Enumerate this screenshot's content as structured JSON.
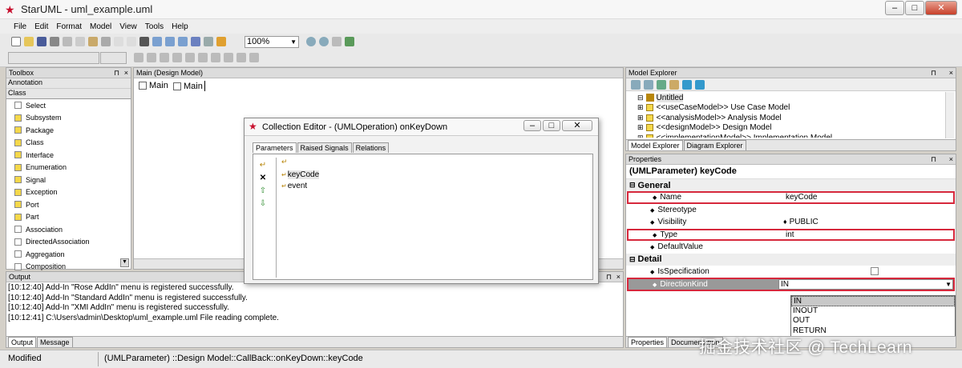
{
  "window": {
    "title": "StarUML - uml_example.uml"
  },
  "menu": [
    "File",
    "Edit",
    "Format",
    "Model",
    "View",
    "Tools",
    "Help"
  ],
  "toolbar": {
    "zoom": "100%"
  },
  "toolbox": {
    "header": "Toolbox",
    "groups": [
      "Annotation",
      "Class"
    ],
    "items": [
      "Select",
      "Subsystem",
      "Package",
      "Class",
      "Interface",
      "Enumeration",
      "Signal",
      "Exception",
      "Port",
      "Part",
      "Association",
      "DirectedAssociation",
      "Aggregation",
      "Composition"
    ]
  },
  "diagram": {
    "header": "Main (Design Model)",
    "tabs": [
      "Main",
      "Main"
    ]
  },
  "dialog": {
    "title": "Collection Editor - (UMLOperation) onKeyDown",
    "tabs": [
      "Parameters",
      "Raised Signals",
      "Relations"
    ],
    "params": [
      "keyCode",
      "event"
    ]
  },
  "model_explorer": {
    "header": "Model Explorer",
    "root": "Untitled",
    "items": [
      "<<useCaseModel>> Use Case Model",
      "<<analysisModel>> Analysis Model",
      "<<designModel>> Design Model",
      "<<implementationModel>> Implementation Model"
    ],
    "tabs": [
      "Model Explorer",
      "Diagram Explorer"
    ]
  },
  "properties": {
    "header": "Properties",
    "title": "(UMLParameter) keyCode",
    "general": "General",
    "detail": "Detail",
    "rows": [
      {
        "name": "Name",
        "value": "keyCode"
      },
      {
        "name": "Stereotype",
        "value": ""
      },
      {
        "name": "Visibility",
        "value": "PUBLIC"
      },
      {
        "name": "Type",
        "value": "int"
      },
      {
        "name": "DefaultValue",
        "value": ""
      }
    ],
    "detail_rows": [
      {
        "name": "IsSpecification",
        "value": ""
      },
      {
        "name": "DirectionKind",
        "value": "IN"
      }
    ],
    "dropdown_options": [
      "IN",
      "INOUT",
      "OUT",
      "RETURN"
    ],
    "tabs": [
      "Properties",
      "Documentation"
    ]
  },
  "output": {
    "header": "Output",
    "lines": [
      "[10:12:40]  Add-In \"Rose AddIn\" menu is registered successfully.",
      "[10:12:40]  Add-In \"Standard AddIn\" menu is registered successfully.",
      "[10:12:40]  Add-In \"XMI AddIn\" menu is registered successfully.",
      "[10:12:41]  C:\\Users\\admin\\Desktop\\uml_example.uml File reading complete."
    ],
    "tabs": [
      "Output",
      "Message"
    ]
  },
  "status": {
    "left": "Modified",
    "path": "(UMLParameter) ::Design Model::CallBack::onKeyDown::keyCode"
  },
  "watermark": "掘金技术社区 @ TechLearn"
}
